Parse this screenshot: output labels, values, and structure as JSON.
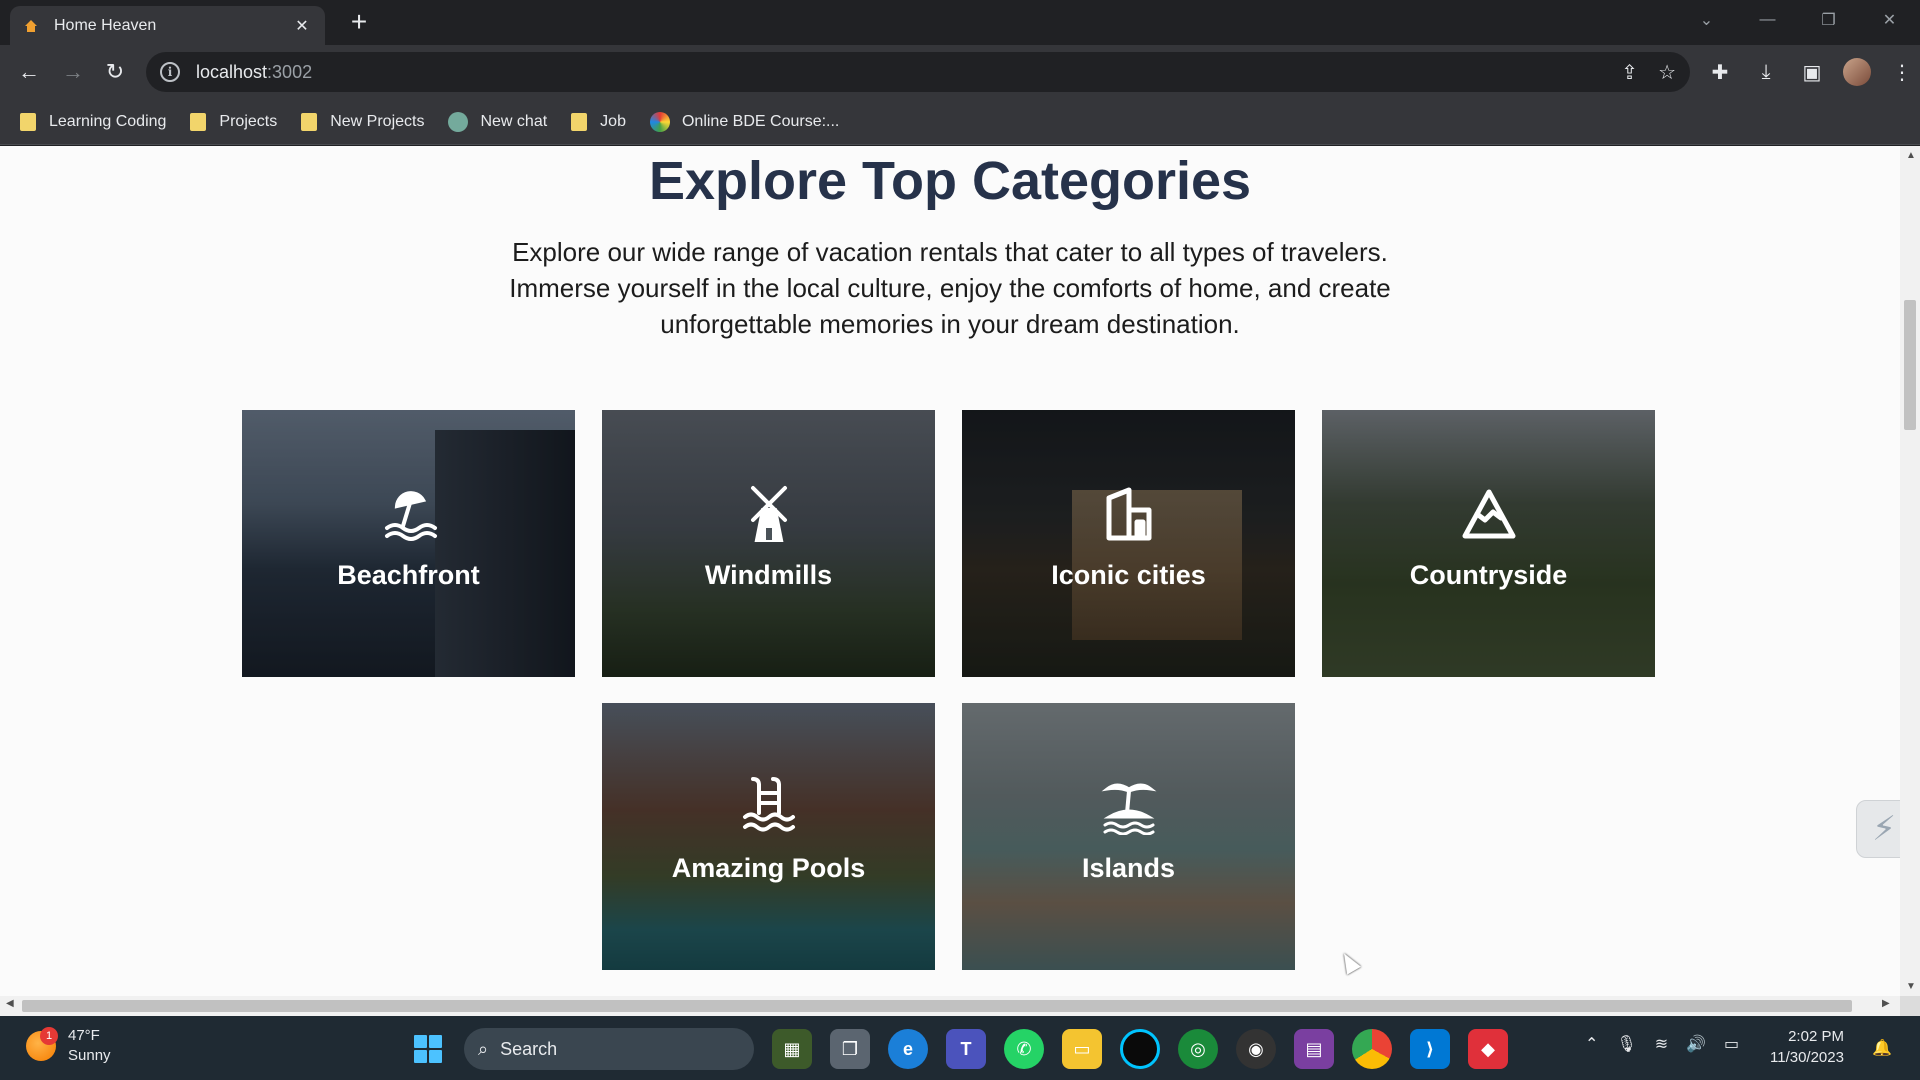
{
  "browser": {
    "tab_title": "Home Heaven",
    "tab_close": "✕",
    "new_tab": "+",
    "url_host": "localhost",
    "url_port": ":3002",
    "window_controls": [
      "⌄",
      "—",
      "❐",
      "✕"
    ]
  },
  "bookmarks": [
    {
      "label": "Learning Coding",
      "icon": "folder-icon"
    },
    {
      "label": "Projects",
      "icon": "folder-icon"
    },
    {
      "label": "New Projects",
      "icon": "folder-icon"
    },
    {
      "label": "New chat",
      "icon": "chatgpt-icon"
    },
    {
      "label": "Job",
      "icon": "folder-icon"
    },
    {
      "label": "Online BDE Course:...",
      "icon": "course-icon"
    }
  ],
  "page": {
    "heading": "Explore Top Categories",
    "description": "Explore our wide range of vacation rentals that cater to all types of travelers. Immerse yourself in the local culture, enjoy the comforts of home, and create unforgettable memories in your dream destination."
  },
  "categories": [
    {
      "label": "Beachfront",
      "icon": "beach-umbrella-icon"
    },
    {
      "label": "Windmills",
      "icon": "windmill-icon"
    },
    {
      "label": "Iconic cities",
      "icon": "city-building-icon"
    },
    {
      "label": "Countryside",
      "icon": "mountain-icon"
    },
    {
      "label": "Amazing Pools",
      "icon": "pool-ladder-icon"
    },
    {
      "label": "Islands",
      "icon": "palm-island-icon"
    }
  ],
  "taskbar": {
    "weather_badge": "1",
    "temperature": "47°F",
    "condition": "Sunny",
    "search_placeholder": "Search",
    "time": "2:02 PM",
    "date": "11/30/2023"
  },
  "colors": {
    "heading": "#26324a",
    "page_bg": "#fbfbfb",
    "chrome_dark": "#202124",
    "chrome_toolbar": "#35363a",
    "taskbar": "#1f2a33"
  }
}
